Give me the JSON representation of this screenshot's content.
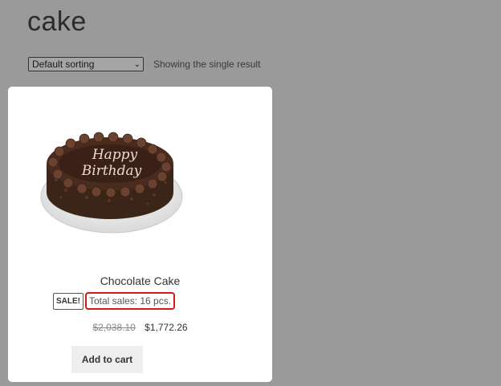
{
  "page": {
    "title": "cake"
  },
  "toolbar": {
    "sort_selected": "Default sorting",
    "result_count": "Showing the single result"
  },
  "product": {
    "name": "Chocolate Cake",
    "image_text": "Happy Birthday",
    "sale_badge": "SALE!",
    "total_sales": "Total sales: 16 pcs.",
    "price_old": "$2,038.10",
    "price_new": "$1,772.26",
    "add_to_cart": "Add to cart"
  },
  "colors": {
    "background": "#9a9a9a",
    "card": "#ffffff",
    "highlight_border": "#d11a1a",
    "button_bg": "#eeeeee"
  }
}
